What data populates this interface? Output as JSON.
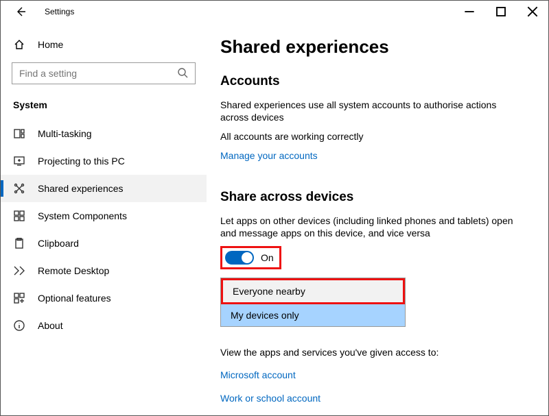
{
  "window": {
    "title": "Settings"
  },
  "sidebar": {
    "home": "Home",
    "search_placeholder": "Find a setting",
    "category": "System",
    "items": [
      {
        "label": "Multi-tasking"
      },
      {
        "label": "Projecting to this PC"
      },
      {
        "label": "Shared experiences"
      },
      {
        "label": "System Components"
      },
      {
        "label": "Clipboard"
      },
      {
        "label": "Remote Desktop"
      },
      {
        "label": "Optional features"
      },
      {
        "label": "About"
      }
    ]
  },
  "page": {
    "title": "Shared experiences",
    "accounts": {
      "heading": "Accounts",
      "desc": "Shared experiences use all system accounts to authorise actions across devices",
      "status": "All accounts are working correctly",
      "manage_link": "Manage your accounts"
    },
    "share_devices": {
      "heading": "Share across devices",
      "desc": "Let apps on other devices (including linked phones and tablets) open and message apps on this device, and vice versa",
      "toggle_state": "On",
      "options": {
        "opt0": "Everyone nearby",
        "opt1": "My devices only"
      },
      "selected_option": "My devices only"
    },
    "access": {
      "desc": "View the apps and services you've given access to:",
      "link1": "Microsoft account",
      "link2": "Work or school account"
    }
  }
}
